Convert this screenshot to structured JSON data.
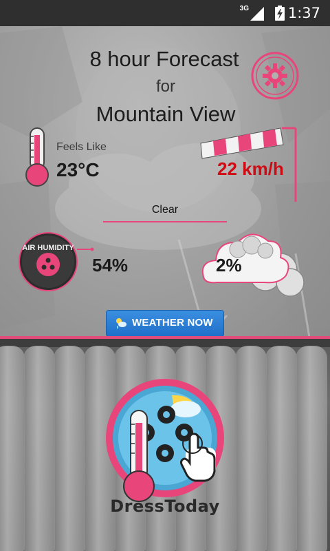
{
  "status": {
    "network": "3G",
    "time": "1:37"
  },
  "header": {
    "title": "8 hour Forecast",
    "connector": "for",
    "location": "Mountain View"
  },
  "weather": {
    "feels_like_label": "Feels Like",
    "temperature": "23°C",
    "wind_speed": "22 km/h",
    "condition": "Clear",
    "humidity_badge_label": "AIR HUMIDITY",
    "humidity": "54%",
    "precipitation": "2%"
  },
  "actions": {
    "weather_now_label": "WEATHER NOW"
  },
  "app": {
    "name": "DressToday"
  },
  "colors": {
    "accent": "#e8457b",
    "wind_text": "#cf0b14",
    "button": "#2a7fd6",
    "status_bar": "#2f2f2f"
  },
  "icons": [
    "settings-gear-icon",
    "thermometer-icon",
    "windsock-icon",
    "air-humidity-icon",
    "rain-cloud-icon",
    "weather-now-icon",
    "dress-today-logo-icon"
  ]
}
